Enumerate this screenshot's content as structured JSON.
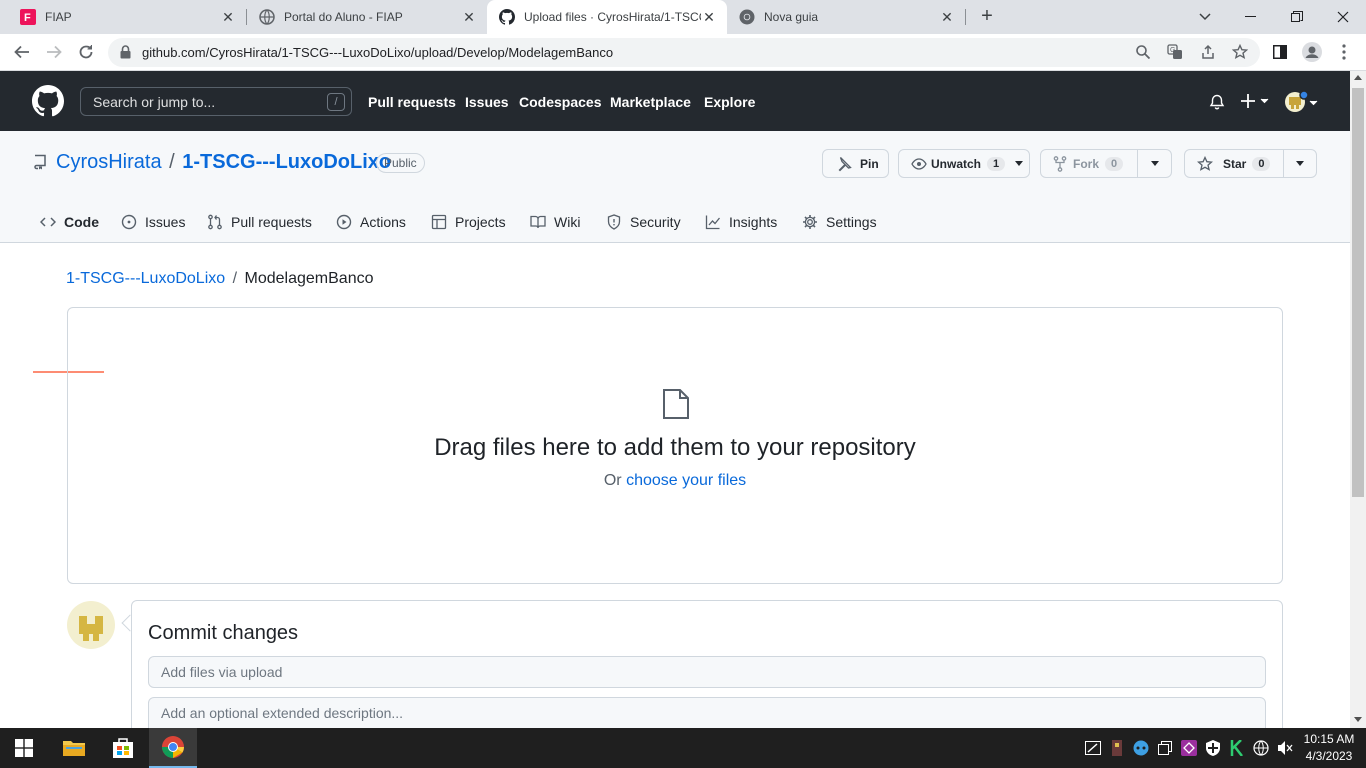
{
  "browser": {
    "tabs": [
      {
        "title": "FIAP",
        "active": false
      },
      {
        "title": "Portal do Aluno - FIAP",
        "active": false
      },
      {
        "title": "Upload files · CyrosHirata/1-TSCG",
        "active": true
      },
      {
        "title": "Nova guia",
        "active": false
      }
    ],
    "url": "github.com/CyrosHirata/1-TSCG---LuxoDoLixo/upload/Develop/ModelagemBanco"
  },
  "gh_header": {
    "search_placeholder": "Search or jump to...",
    "search_shortcut": "/",
    "nav": [
      "Pull requests",
      "Issues",
      "Codespaces",
      "Marketplace",
      "Explore"
    ]
  },
  "repo": {
    "owner": "CyrosHirata",
    "separator": "/",
    "name": "1-TSCG---LuxoDoLixo",
    "visibility": "Public",
    "pin_label": "Pin",
    "unwatch_label": "Unwatch",
    "unwatch_count": "1",
    "fork_label": "Fork",
    "fork_count": "0",
    "star_label": "Star",
    "star_count": "0",
    "tabs": [
      "Code",
      "Issues",
      "Pull requests",
      "Actions",
      "Projects",
      "Wiki",
      "Security",
      "Insights",
      "Settings"
    ]
  },
  "breadcrumb": {
    "repo_link": "1-TSCG---LuxoDoLixo",
    "separator": "/",
    "folder": "ModelagemBanco"
  },
  "dropzone": {
    "heading": "Drag files here to add them to your repository",
    "or_text": "Or",
    "choose_link": "choose your files"
  },
  "commit": {
    "title": "Commit changes",
    "summary_placeholder": "Add files via upload",
    "description_placeholder": "Add an optional extended description..."
  },
  "taskbar": {
    "time": "10:15 AM",
    "date": "4/3/2023"
  },
  "colors": {
    "gh_header_bg": "#24292f",
    "link_blue": "#0969da",
    "active_tab_underline": "#fd8c73"
  }
}
